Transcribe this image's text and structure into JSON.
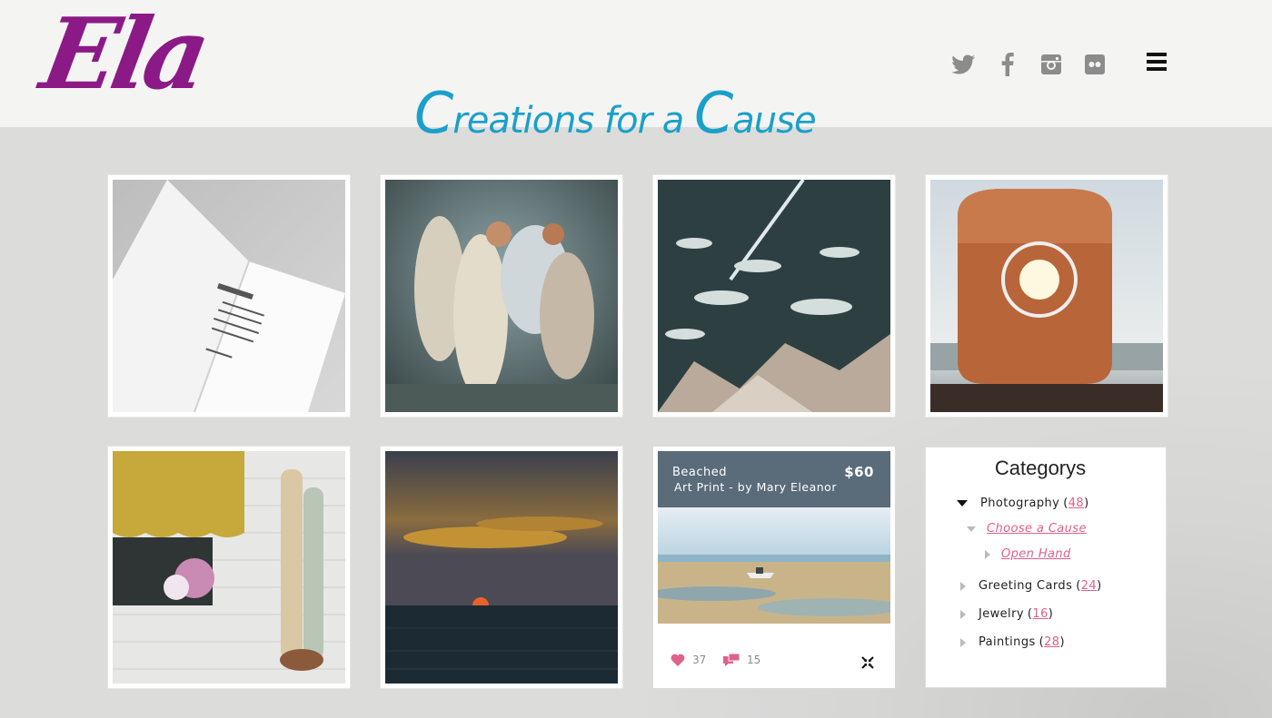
{
  "brand": {
    "logo": "Ela",
    "tagline_parts": [
      {
        "cap": "C",
        "rest": "reations for a "
      },
      {
        "cap": "C",
        "rest": "ause"
      }
    ]
  },
  "social": [
    "twitter-icon",
    "facebook-icon",
    "instagram-icon",
    "flickr-icon"
  ],
  "menu": {
    "icon": "hamburger-icon"
  },
  "tiles": [
    {
      "name": "greeting-card-thumbnail",
      "subject": "greeting card"
    },
    {
      "name": "fairies-painting-thumbnail",
      "subject": "painting"
    },
    {
      "name": "abstract-painting-thumbnail",
      "subject": "painting"
    },
    {
      "name": "life-raft-photo-thumbnail",
      "subject": "photo"
    },
    {
      "name": "buoys-house-photo-thumbnail",
      "subject": "photo"
    },
    {
      "name": "sunset-photo-thumbnail",
      "subject": "photo"
    }
  ],
  "product": {
    "title": "Beached",
    "subtitle": "Art Print - by Mary Eleanor",
    "price": "$60",
    "likes": "37",
    "comments": "15"
  },
  "categories": {
    "heading": "Categorys",
    "items": [
      {
        "label": "Photography",
        "count": "48",
        "expanded": true
      },
      {
        "label": "Choose a Cause",
        "sub": true,
        "expanded": true
      },
      {
        "label": "Open Hand",
        "sub": true
      },
      {
        "label": "Greeting Cards",
        "count": "24"
      },
      {
        "label": "Jewelry",
        "count": "16"
      },
      {
        "label": "Paintings",
        "count": "28"
      }
    ]
  },
  "colors": {
    "logo": "#8b1a86",
    "tagline": "#1aa0c9",
    "accent_pink": "#e0608c",
    "product_header": "#5a6b7a"
  }
}
